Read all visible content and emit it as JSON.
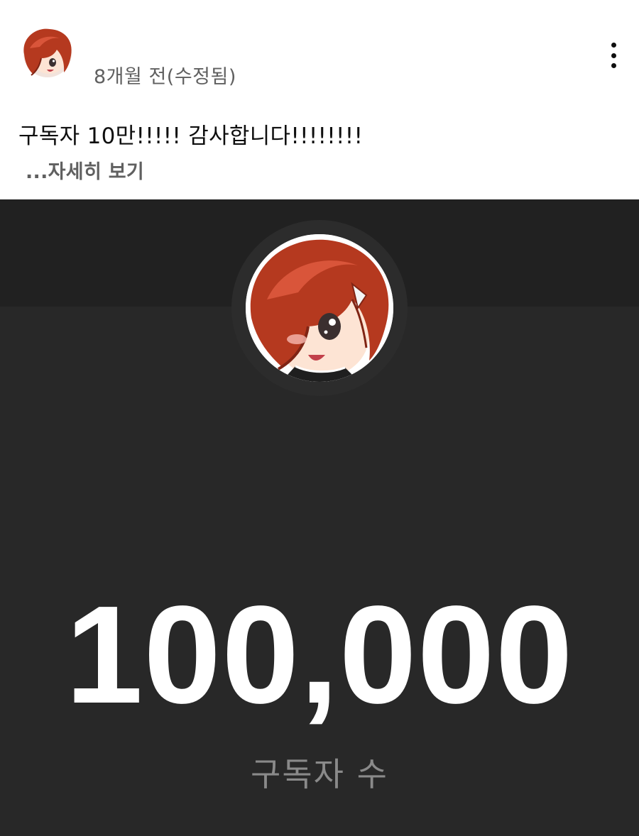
{
  "post": {
    "timestamp": "8개월 전(수정됨)",
    "text": "구독자 10만!!!!! 감사합니다!!!!!!!!",
    "read_more": "...자세히 보기"
  },
  "card": {
    "channel_name": "",
    "subscriber_count": "100,000",
    "subscriber_label": "구독자 수"
  },
  "colors": {
    "card_background": "#282828",
    "banner_background": "#212121",
    "hair": "#b5391f",
    "hair_shadow": "#7f2414",
    "skin": "#fde4d4"
  },
  "icons": {
    "more": "more-vertical-icon"
  }
}
